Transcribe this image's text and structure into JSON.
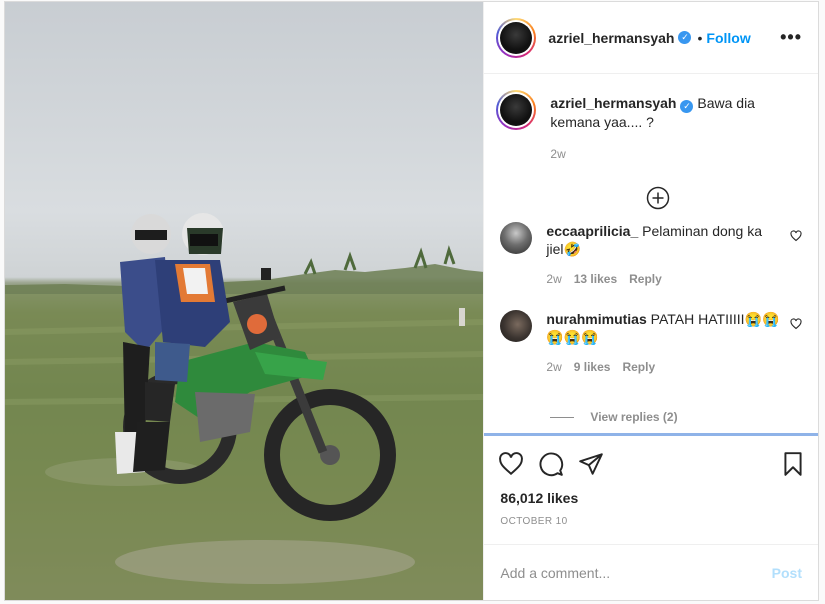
{
  "post": {
    "photo_alt": "Two riders on a green dirt bike in a field",
    "author": {
      "username": "azriel_hermansyah",
      "verified": true,
      "follow_label": "Follow",
      "separator": "•",
      "more_label": "•••"
    },
    "caption": {
      "username": "azriel_hermansyah",
      "text": "Bawa dia kemana yaa.... ?",
      "time": "2w"
    },
    "comments": [
      {
        "username": "eccaaprilicia_",
        "text": "Pelaminan dong ka jiel🤣",
        "time": "2w",
        "likes": "13 likes",
        "reply_label": "Reply"
      },
      {
        "username": "nurahmimutias",
        "text": "PATAH HATIIIII😭😭😭😭😭",
        "time": "2w",
        "likes": "9 likes",
        "reply_label": "Reply"
      }
    ],
    "view_replies_label": "View replies (2)",
    "likes_count": "86,012 likes",
    "date": "OCTOBER 10",
    "comment_input": {
      "placeholder": "Add a comment...",
      "value": ""
    },
    "post_button_label": "Post",
    "colors": {
      "accent": "#0095f6",
      "verified": "#3897f0",
      "post_disabled": "#b2dffc",
      "meta_gray": "#8e8e8e"
    },
    "icons": [
      "verified-icon",
      "more-options-icon",
      "add-circle-icon",
      "heart-icon",
      "comment-icon",
      "share-icon",
      "bookmark-icon"
    ]
  }
}
